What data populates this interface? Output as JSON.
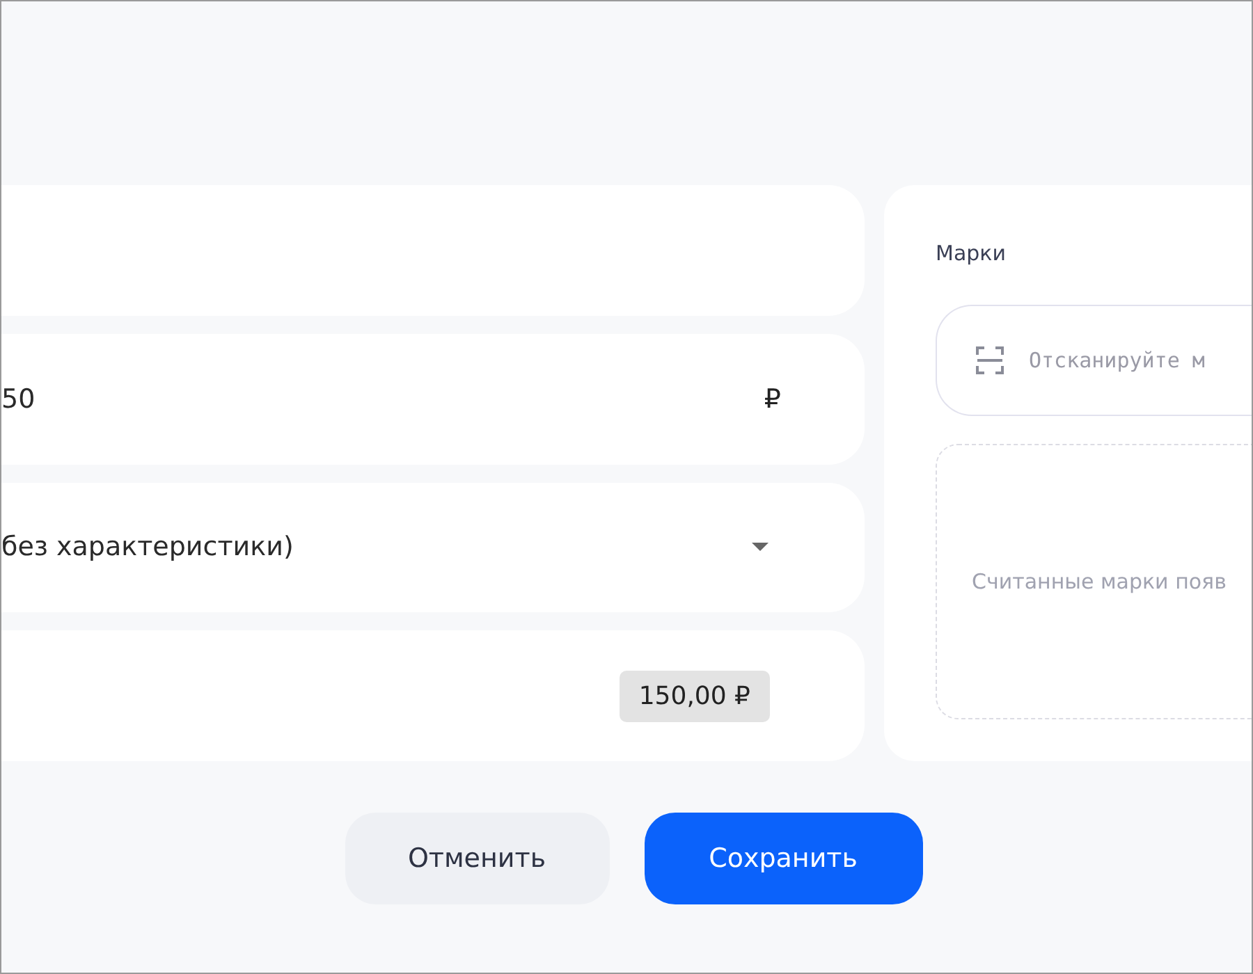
{
  "form_fields": [
    {
      "kind": "empty"
    },
    {
      "kind": "price",
      "value": "50",
      "currency": "₽"
    },
    {
      "kind": "select",
      "value": "без характеристики)"
    },
    {
      "kind": "total",
      "value": "150,00 ₽"
    }
  ],
  "marks_panel": {
    "title": "Марки",
    "scan_field": {
      "placeholder": "Отсканируйте м"
    },
    "empty_hint": "Считанные марки появ"
  },
  "buttons": [
    {
      "label": "Отменить",
      "kind": "secondary"
    },
    {
      "label": "Сохранить",
      "kind": "primary"
    }
  ]
}
